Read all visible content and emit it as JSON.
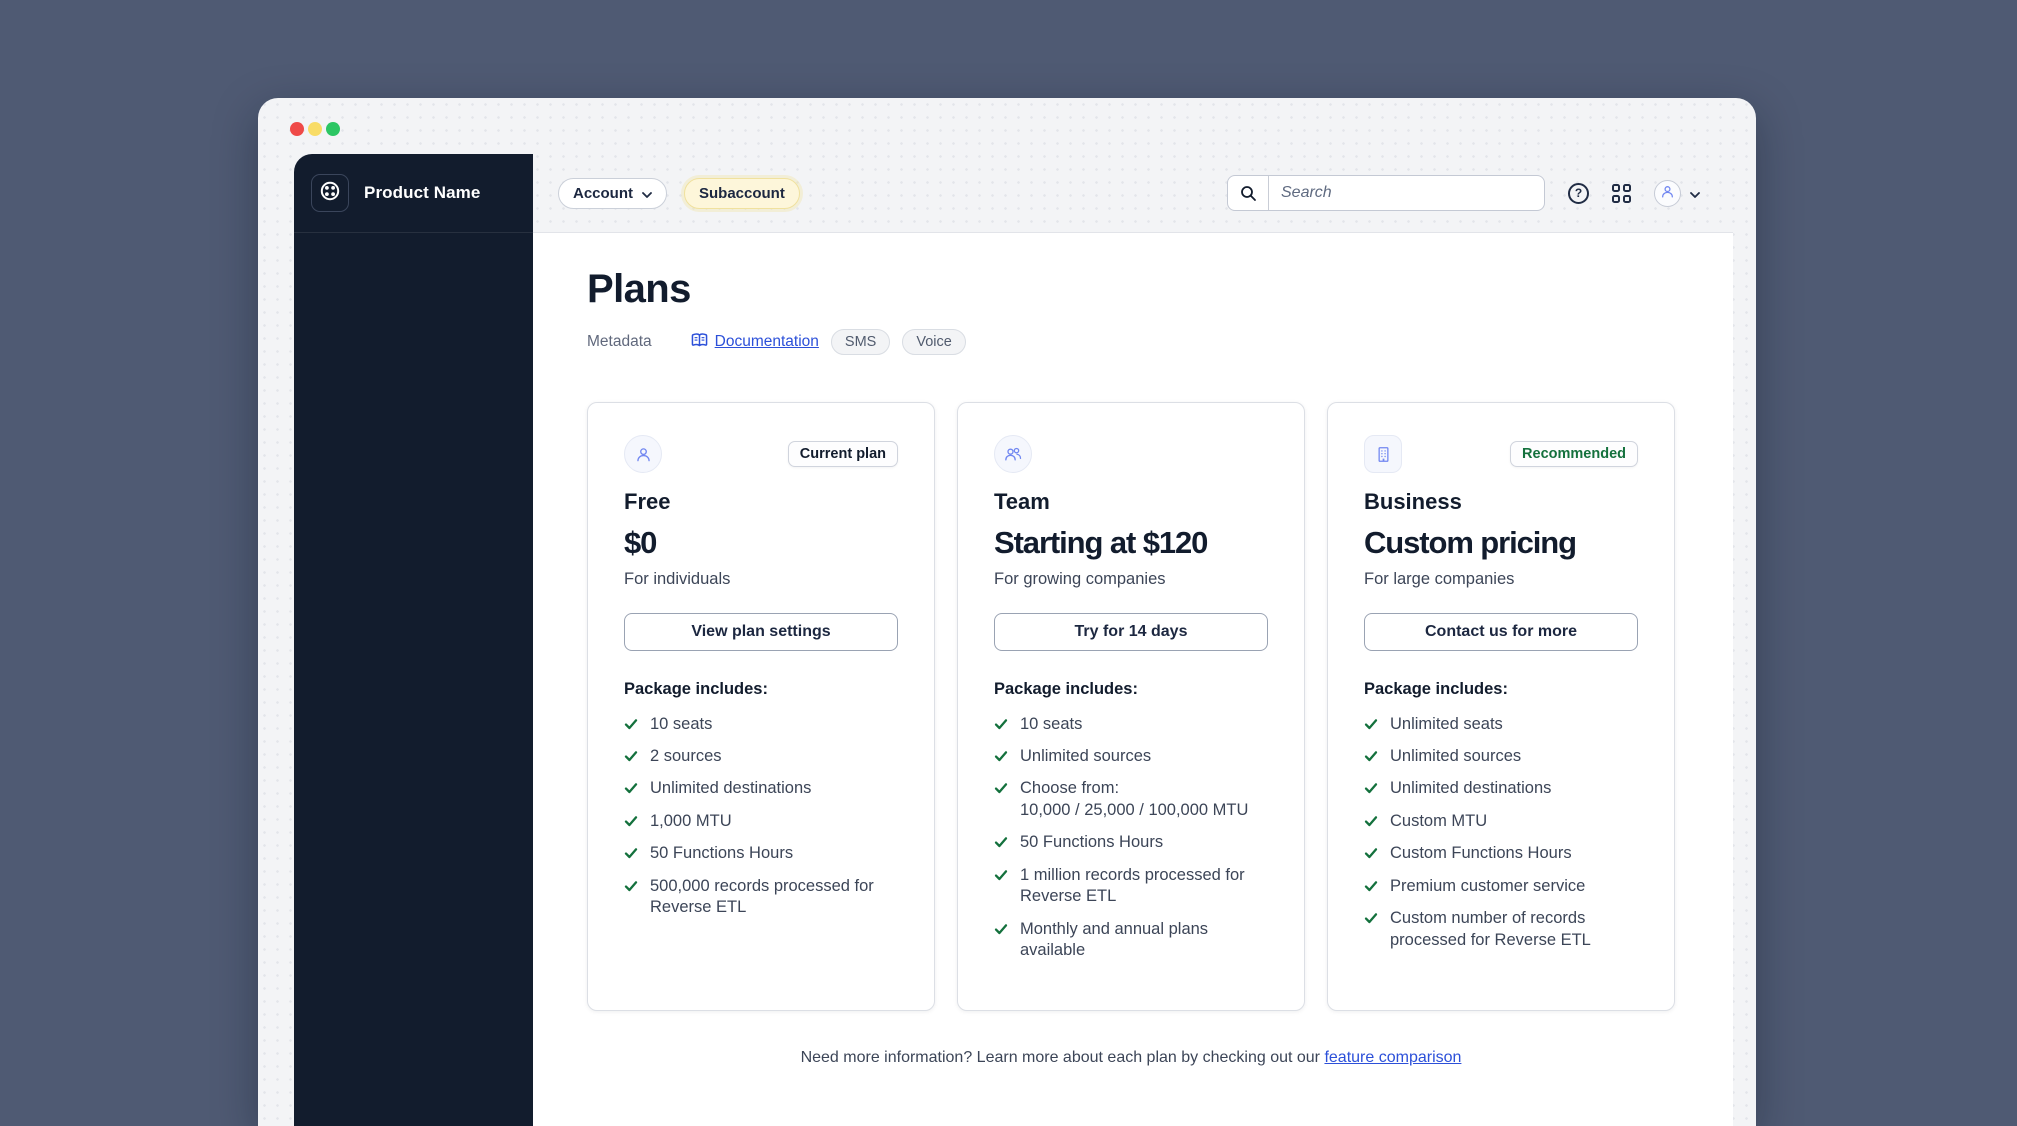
{
  "colors": {
    "page_background": "#4f5a73",
    "sidebar_background": "#121c2d",
    "accent_blue": "#7187f1",
    "link_blue": "#2c50d9",
    "success_green": "#14713d",
    "subaccount_yellow_bg": "#fdf6da",
    "subaccount_yellow_border": "#f0e19e",
    "traffic_red": "#ef4a48",
    "traffic_yellow": "#f8dc66",
    "traffic_green": "#2cc663"
  },
  "window": {
    "controls": [
      "close",
      "minimize",
      "zoom"
    ]
  },
  "sidebar": {
    "product_name": "Product Name",
    "logo_icon": "product-logo-icon"
  },
  "topbar": {
    "account": {
      "label": "Account",
      "chevron_icon": "chevron-down-icon"
    },
    "subaccount_label": "Subaccount",
    "search": {
      "icon": "search-icon",
      "placeholder": "Search"
    },
    "icons": {
      "help": "help-icon",
      "apps": "apps-grid-icon",
      "avatar": "user-avatar-icon",
      "chevron": "chevron-down-icon"
    }
  },
  "main": {
    "title": "Plans",
    "meta_row": {
      "metadata_label": "Metadata",
      "documentation_link": "Documentation",
      "documentation_icon": "book-icon",
      "tags": [
        "SMS",
        "Voice"
      ]
    },
    "plans": [
      {
        "icon": "user-icon",
        "badge": "Current plan",
        "name": "Free",
        "price": "$0",
        "audience": "For individuals",
        "cta": "View plan settings",
        "package_label": "Package includes:",
        "features": [
          "10 seats",
          "2 sources",
          "Unlimited destinations",
          "1,000 MTU",
          "50 Functions Hours",
          "500,000 records processed for Reverse ETL"
        ]
      },
      {
        "icon": "team-icon",
        "name": "Team",
        "price": "Starting at $120",
        "audience": "For growing companies",
        "cta": "Try for 14 days",
        "package_label": "Package includes:",
        "features": [
          "10 seats",
          "Unlimited sources",
          "Choose from:\n10,000 / 25,000 / 100,000 MTU",
          "50 Functions Hours",
          "1 million records processed for Reverse ETL",
          "Monthly and annual plans available"
        ]
      },
      {
        "icon": "building-icon",
        "badge": "Recommended",
        "name": "Business",
        "price": "Custom pricing",
        "audience": "For large companies",
        "cta": "Contact us for more",
        "package_label": "Package includes:",
        "features": [
          "Unlimited seats",
          "Unlimited sources",
          "Unlimited destinations",
          "Custom MTU",
          "Custom Functions Hours",
          "Premium customer service",
          "Custom number of records processed for Reverse ETL"
        ]
      }
    ],
    "footer": {
      "text": "Need more information? Learn more about each plan by checking out our ",
      "link_label": "feature comparison"
    }
  }
}
